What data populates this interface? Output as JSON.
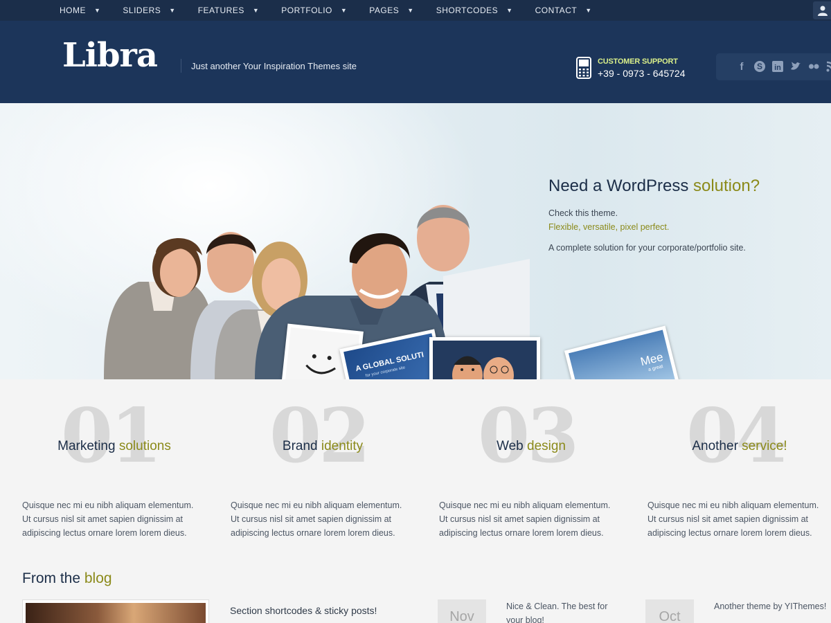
{
  "nav": {
    "items": [
      {
        "label": "HOME"
      },
      {
        "label": "SLIDERS"
      },
      {
        "label": "FEATURES"
      },
      {
        "label": "PORTFOLIO"
      },
      {
        "label": "PAGES"
      },
      {
        "label": "SHORTCODES"
      },
      {
        "label": "CONTACT"
      }
    ]
  },
  "header": {
    "logo": "Libra",
    "tagline": "Just another Your Inspiration Themes site",
    "support_label": "CUSTOMER SUPPORT",
    "support_phone": "+39 - 0973 - 645724",
    "social": [
      "facebook-icon",
      "skype-icon",
      "linkedin-icon",
      "twitter-icon",
      "flickr-icon",
      "rss-icon"
    ]
  },
  "hero": {
    "title_main": "Need a WordPress ",
    "title_accent": "solution?",
    "line1": "Check this theme.",
    "line2": "Flexible, versatile, pixel perfect.",
    "line3": "A complete solution for your corporate/portfolio site.",
    "thumb2_text": "A GLOBAL SOLUTI",
    "thumb2_sub": "for your corporate site",
    "thumb4_text": "Mee",
    "thumb4_sub": "a great"
  },
  "services": [
    {
      "number": "01",
      "title_main": "Marketing ",
      "title_accent": "solutions",
      "desc": "Quisque nec mi eu nibh aliquam elementum. Ut cursus nisl sit amet sapien dignissim at adipiscing lectus ornare lorem lorem dieus."
    },
    {
      "number": "02",
      "title_main": "Brand ",
      "title_accent": "identity",
      "desc": "Quisque nec mi eu nibh aliquam elementum. Ut cursus nisl sit amet sapien dignissim at adipiscing lectus ornare lorem lorem dieus."
    },
    {
      "number": "03",
      "title_main": "Web ",
      "title_accent": "design",
      "desc": "Quisque nec mi eu nibh aliquam elementum. Ut cursus nisl sit amet sapien dignissim at adipiscing lectus ornare lorem lorem dieus."
    },
    {
      "number": "04",
      "title_main": "Another ",
      "title_accent": "service!",
      "desc": "Quisque nec mi eu nibh aliquam elementum. Ut cursus nisl sit amet sapien dignissim at adipiscing lectus ornare lorem lorem dieus."
    }
  ],
  "blog": {
    "heading_main": "From the ",
    "heading_accent": "blog",
    "post_title": "Section shortcodes & sticky posts!",
    "date1": "Nov",
    "tweet1": "Nice & Clean. The best for your blog!",
    "date2": "Oct",
    "tweet2": "Another theme by YIThemes!"
  },
  "colors": {
    "nav_bg": "#1b2e4a",
    "header_bg": "#1c355a",
    "accent": "#8b8a1a",
    "heading": "#1c2e48",
    "support_label": "#d9ef8a"
  }
}
